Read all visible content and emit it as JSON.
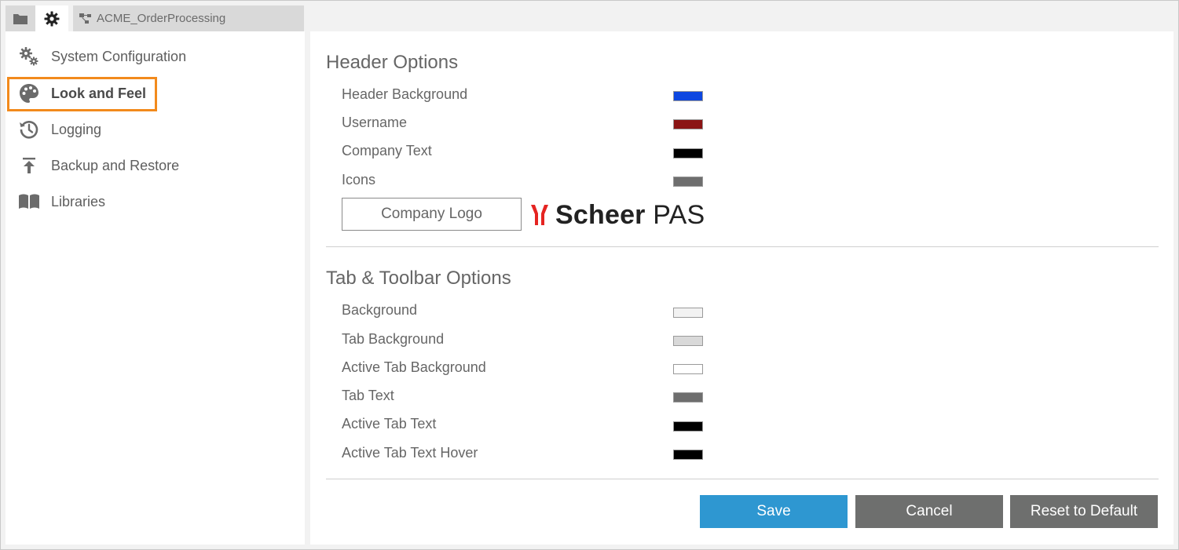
{
  "tabs": {
    "folder_icon": "folder-icon",
    "settings_icon": "gear-icon",
    "process_icon": "process-icon",
    "process_label": "ACME_OrderProcessing"
  },
  "sidebar": {
    "items": [
      {
        "label": "System Configuration",
        "icon": "gears-icon",
        "active": false
      },
      {
        "label": "Look and Feel",
        "icon": "palette-icon",
        "active": true
      },
      {
        "label": "Logging",
        "icon": "history-icon",
        "active": false
      },
      {
        "label": "Backup and Restore",
        "icon": "upload-icon",
        "active": false
      },
      {
        "label": "Libraries",
        "icon": "book-icon",
        "active": false
      }
    ],
    "highlight_color": "#f28a1c"
  },
  "header_options": {
    "title": "Header Options",
    "rows": [
      {
        "label": "Header Background",
        "color": "#0d47e0"
      },
      {
        "label": "Username",
        "color": "#8b1414"
      },
      {
        "label": "Company Text",
        "color": "#000000"
      },
      {
        "label": "Icons",
        "color": "#6e6e6e"
      }
    ],
    "logo_button": "Company Logo",
    "brand_bold": "Scheer",
    "brand_light": "PAS"
  },
  "tab_toolbar_options": {
    "title": "Tab & Toolbar Options",
    "rows": [
      {
        "label": "Background",
        "color": "#f2f2f2"
      },
      {
        "label": "Tab Background",
        "color": "#d9d9d9"
      },
      {
        "label": "Active Tab Background",
        "color": "#ffffff"
      },
      {
        "label": "Tab Text",
        "color": "#6e6e6e"
      },
      {
        "label": "Active Tab Text",
        "color": "#000000"
      },
      {
        "label": "Active Tab Text Hover",
        "color": "#000000"
      }
    ]
  },
  "actions": {
    "save": "Save",
    "cancel": "Cancel",
    "reset": "Reset to Default"
  },
  "colors": {
    "accent": "#2e97d1",
    "secondary_button": "#6e6f6e",
    "brand_red": "#e52421"
  }
}
